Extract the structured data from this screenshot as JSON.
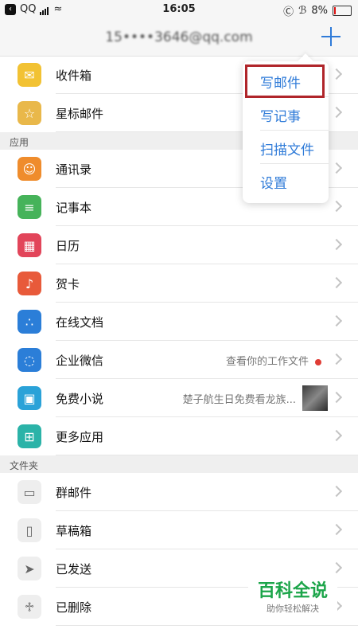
{
  "status": {
    "carrier": "QQ",
    "time": "16:05",
    "battery": "8%",
    "battery_level": 0.08
  },
  "header": {
    "account": "15••••3646@qq.com",
    "add_label": "+"
  },
  "top_items": [
    {
      "label": "收件箱",
      "icon": "inbox-icon",
      "color": "#f2c233"
    },
    {
      "label": "星标邮件",
      "icon": "star-icon",
      "color": "#e9b84a"
    }
  ],
  "apps_section": "应用",
  "apps": [
    {
      "label": "通讯录",
      "icon": "contacts-icon",
      "color": "#ef8c2c",
      "sub": ""
    },
    {
      "label": "记事本",
      "icon": "notes-icon",
      "color": "#46b35a",
      "sub": ""
    },
    {
      "label": "日历",
      "icon": "calendar-icon",
      "color": "#e2455a",
      "sub": ""
    },
    {
      "label": "贺卡",
      "icon": "card-icon",
      "color": "#e85a3a",
      "sub": ""
    },
    {
      "label": "在线文档",
      "icon": "docs-icon",
      "color": "#2b7ed8",
      "sub": ""
    },
    {
      "label": "企业微信",
      "icon": "wecom-icon",
      "color": "#2b7ed8",
      "sub": "查看你的工作文件"
    },
    {
      "label": "免费小说",
      "icon": "novel-icon",
      "color": "#2aa2d8",
      "sub": "楚子航生日免费看龙族..."
    },
    {
      "label": "更多应用",
      "icon": "grid-icon",
      "color": "#2bb3a8",
      "sub": ""
    }
  ],
  "folders_section": "文件夹",
  "folders": [
    {
      "label": "群邮件",
      "icon": "folder-icon"
    },
    {
      "label": "草稿箱",
      "icon": "draft-icon"
    },
    {
      "label": "已发送",
      "icon": "send-icon"
    },
    {
      "label": "已删除",
      "icon": "trash-icon"
    }
  ],
  "popup": [
    "写邮件",
    "写记事",
    "扫描文件",
    "设置"
  ],
  "watermark": {
    "title": "百科全说",
    "subtitle": "助你轻松解决"
  }
}
